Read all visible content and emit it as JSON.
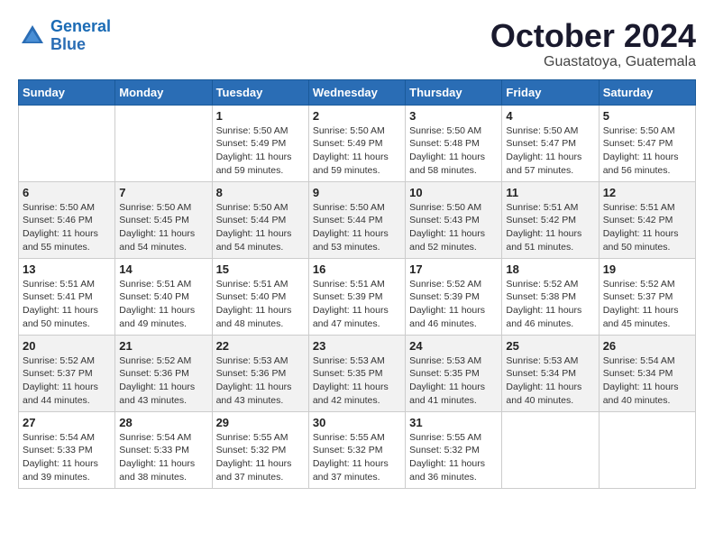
{
  "header": {
    "logo_line1": "General",
    "logo_line2": "Blue",
    "month_title": "October 2024",
    "subtitle": "Guastatoya, Guatemala"
  },
  "weekdays": [
    "Sunday",
    "Monday",
    "Tuesday",
    "Wednesday",
    "Thursday",
    "Friday",
    "Saturday"
  ],
  "weeks": [
    [
      {
        "day": "",
        "info": ""
      },
      {
        "day": "",
        "info": ""
      },
      {
        "day": "1",
        "info": "Sunrise: 5:50 AM\nSunset: 5:49 PM\nDaylight: 11 hours and 59 minutes."
      },
      {
        "day": "2",
        "info": "Sunrise: 5:50 AM\nSunset: 5:49 PM\nDaylight: 11 hours and 59 minutes."
      },
      {
        "day": "3",
        "info": "Sunrise: 5:50 AM\nSunset: 5:48 PM\nDaylight: 11 hours and 58 minutes."
      },
      {
        "day": "4",
        "info": "Sunrise: 5:50 AM\nSunset: 5:47 PM\nDaylight: 11 hours and 57 minutes."
      },
      {
        "day": "5",
        "info": "Sunrise: 5:50 AM\nSunset: 5:47 PM\nDaylight: 11 hours and 56 minutes."
      }
    ],
    [
      {
        "day": "6",
        "info": "Sunrise: 5:50 AM\nSunset: 5:46 PM\nDaylight: 11 hours and 55 minutes."
      },
      {
        "day": "7",
        "info": "Sunrise: 5:50 AM\nSunset: 5:45 PM\nDaylight: 11 hours and 54 minutes."
      },
      {
        "day": "8",
        "info": "Sunrise: 5:50 AM\nSunset: 5:44 PM\nDaylight: 11 hours and 54 minutes."
      },
      {
        "day": "9",
        "info": "Sunrise: 5:50 AM\nSunset: 5:44 PM\nDaylight: 11 hours and 53 minutes."
      },
      {
        "day": "10",
        "info": "Sunrise: 5:50 AM\nSunset: 5:43 PM\nDaylight: 11 hours and 52 minutes."
      },
      {
        "day": "11",
        "info": "Sunrise: 5:51 AM\nSunset: 5:42 PM\nDaylight: 11 hours and 51 minutes."
      },
      {
        "day": "12",
        "info": "Sunrise: 5:51 AM\nSunset: 5:42 PM\nDaylight: 11 hours and 50 minutes."
      }
    ],
    [
      {
        "day": "13",
        "info": "Sunrise: 5:51 AM\nSunset: 5:41 PM\nDaylight: 11 hours and 50 minutes."
      },
      {
        "day": "14",
        "info": "Sunrise: 5:51 AM\nSunset: 5:40 PM\nDaylight: 11 hours and 49 minutes."
      },
      {
        "day": "15",
        "info": "Sunrise: 5:51 AM\nSunset: 5:40 PM\nDaylight: 11 hours and 48 minutes."
      },
      {
        "day": "16",
        "info": "Sunrise: 5:51 AM\nSunset: 5:39 PM\nDaylight: 11 hours and 47 minutes."
      },
      {
        "day": "17",
        "info": "Sunrise: 5:52 AM\nSunset: 5:39 PM\nDaylight: 11 hours and 46 minutes."
      },
      {
        "day": "18",
        "info": "Sunrise: 5:52 AM\nSunset: 5:38 PM\nDaylight: 11 hours and 46 minutes."
      },
      {
        "day": "19",
        "info": "Sunrise: 5:52 AM\nSunset: 5:37 PM\nDaylight: 11 hours and 45 minutes."
      }
    ],
    [
      {
        "day": "20",
        "info": "Sunrise: 5:52 AM\nSunset: 5:37 PM\nDaylight: 11 hours and 44 minutes."
      },
      {
        "day": "21",
        "info": "Sunrise: 5:52 AM\nSunset: 5:36 PM\nDaylight: 11 hours and 43 minutes."
      },
      {
        "day": "22",
        "info": "Sunrise: 5:53 AM\nSunset: 5:36 PM\nDaylight: 11 hours and 43 minutes."
      },
      {
        "day": "23",
        "info": "Sunrise: 5:53 AM\nSunset: 5:35 PM\nDaylight: 11 hours and 42 minutes."
      },
      {
        "day": "24",
        "info": "Sunrise: 5:53 AM\nSunset: 5:35 PM\nDaylight: 11 hours and 41 minutes."
      },
      {
        "day": "25",
        "info": "Sunrise: 5:53 AM\nSunset: 5:34 PM\nDaylight: 11 hours and 40 minutes."
      },
      {
        "day": "26",
        "info": "Sunrise: 5:54 AM\nSunset: 5:34 PM\nDaylight: 11 hours and 40 minutes."
      }
    ],
    [
      {
        "day": "27",
        "info": "Sunrise: 5:54 AM\nSunset: 5:33 PM\nDaylight: 11 hours and 39 minutes."
      },
      {
        "day": "28",
        "info": "Sunrise: 5:54 AM\nSunset: 5:33 PM\nDaylight: 11 hours and 38 minutes."
      },
      {
        "day": "29",
        "info": "Sunrise: 5:55 AM\nSunset: 5:32 PM\nDaylight: 11 hours and 37 minutes."
      },
      {
        "day": "30",
        "info": "Sunrise: 5:55 AM\nSunset: 5:32 PM\nDaylight: 11 hours and 37 minutes."
      },
      {
        "day": "31",
        "info": "Sunrise: 5:55 AM\nSunset: 5:32 PM\nDaylight: 11 hours and 36 minutes."
      },
      {
        "day": "",
        "info": ""
      },
      {
        "day": "",
        "info": ""
      }
    ]
  ]
}
